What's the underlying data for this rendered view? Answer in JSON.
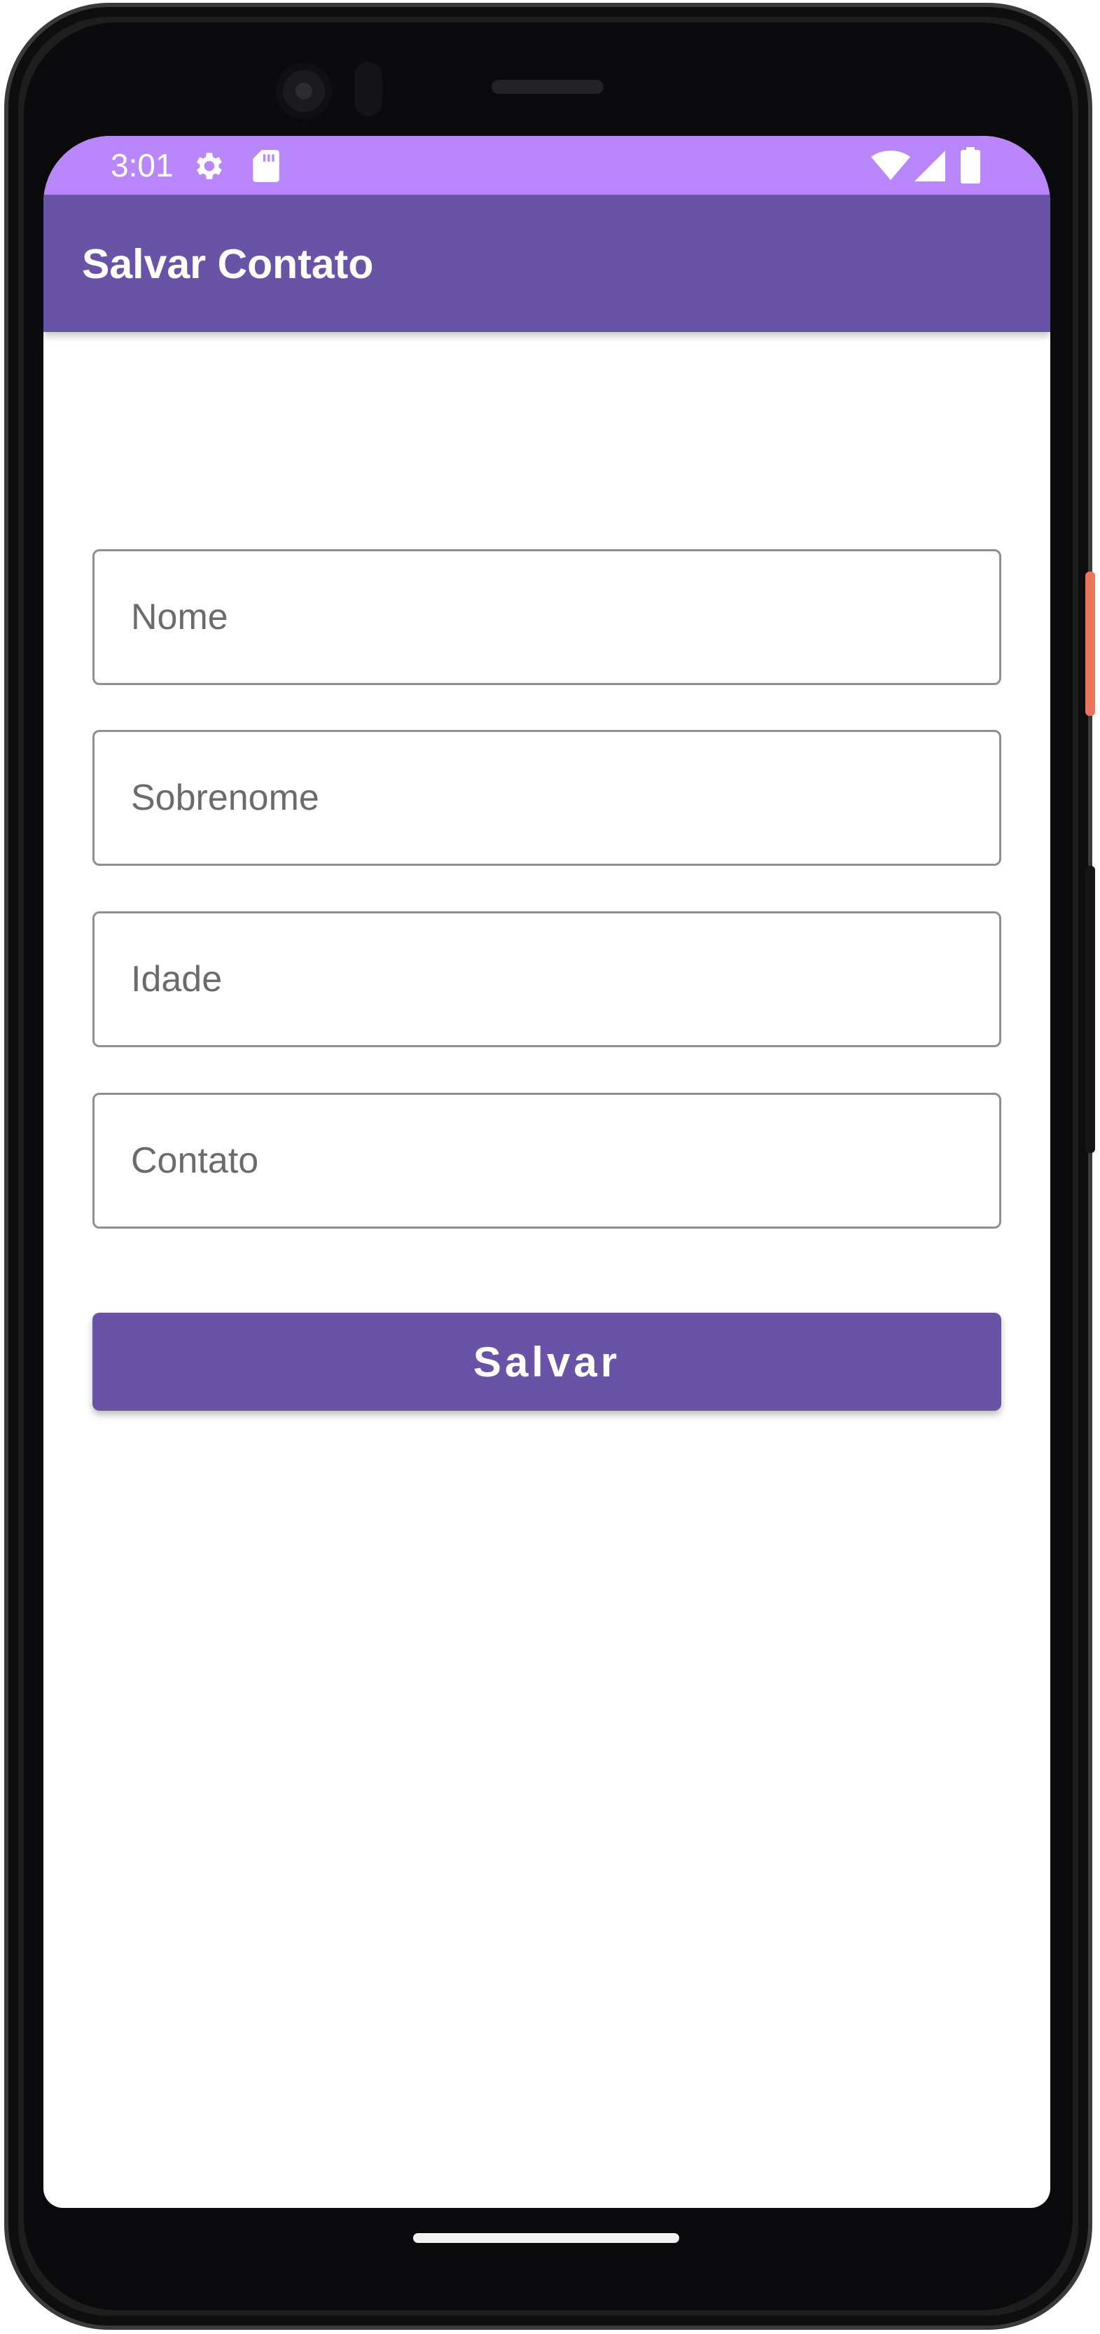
{
  "status_bar": {
    "time": "3:01",
    "color": "#b986fb",
    "icons": [
      "settings-icon",
      "sd-card-icon",
      "wifi-icon",
      "cell-signal-icon",
      "battery-icon"
    ]
  },
  "app_bar": {
    "title": "Salvar Contato",
    "color": "#6953a6"
  },
  "form": {
    "fields": [
      {
        "placeholder": "Nome",
        "value": ""
      },
      {
        "placeholder": "Sobrenome",
        "value": ""
      },
      {
        "placeholder": "Idade",
        "value": ""
      },
      {
        "placeholder": "Contato",
        "value": ""
      }
    ],
    "save_label": "Salvar"
  }
}
